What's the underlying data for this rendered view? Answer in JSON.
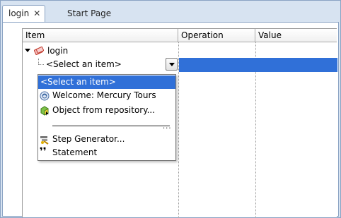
{
  "tabs": [
    {
      "label": "login",
      "active": true
    },
    {
      "label": "Start Page",
      "active": false
    }
  ],
  "grid": {
    "columns": [
      "Item",
      "Operation",
      "Value"
    ],
    "tree": {
      "root_label": "login",
      "child_label": "<Select an item>"
    }
  },
  "dropdown": {
    "items": [
      {
        "label": "<Select an item>",
        "icon": "none",
        "selected": true
      },
      {
        "label": "Welcome: Mercury Tours",
        "icon": "browser-page-icon"
      },
      {
        "label": "Object from repository...",
        "icon": "object-repository-icon"
      },
      {
        "label": "Step Generator...",
        "icon": "step-generator-icon"
      },
      {
        "label": "Statement",
        "icon": "statement-quote-icon"
      }
    ],
    "separator_text": "..."
  },
  "colors": {
    "selection": "#3070d8",
    "frame": "#d7e3f1",
    "border": "#8aa3c3"
  }
}
